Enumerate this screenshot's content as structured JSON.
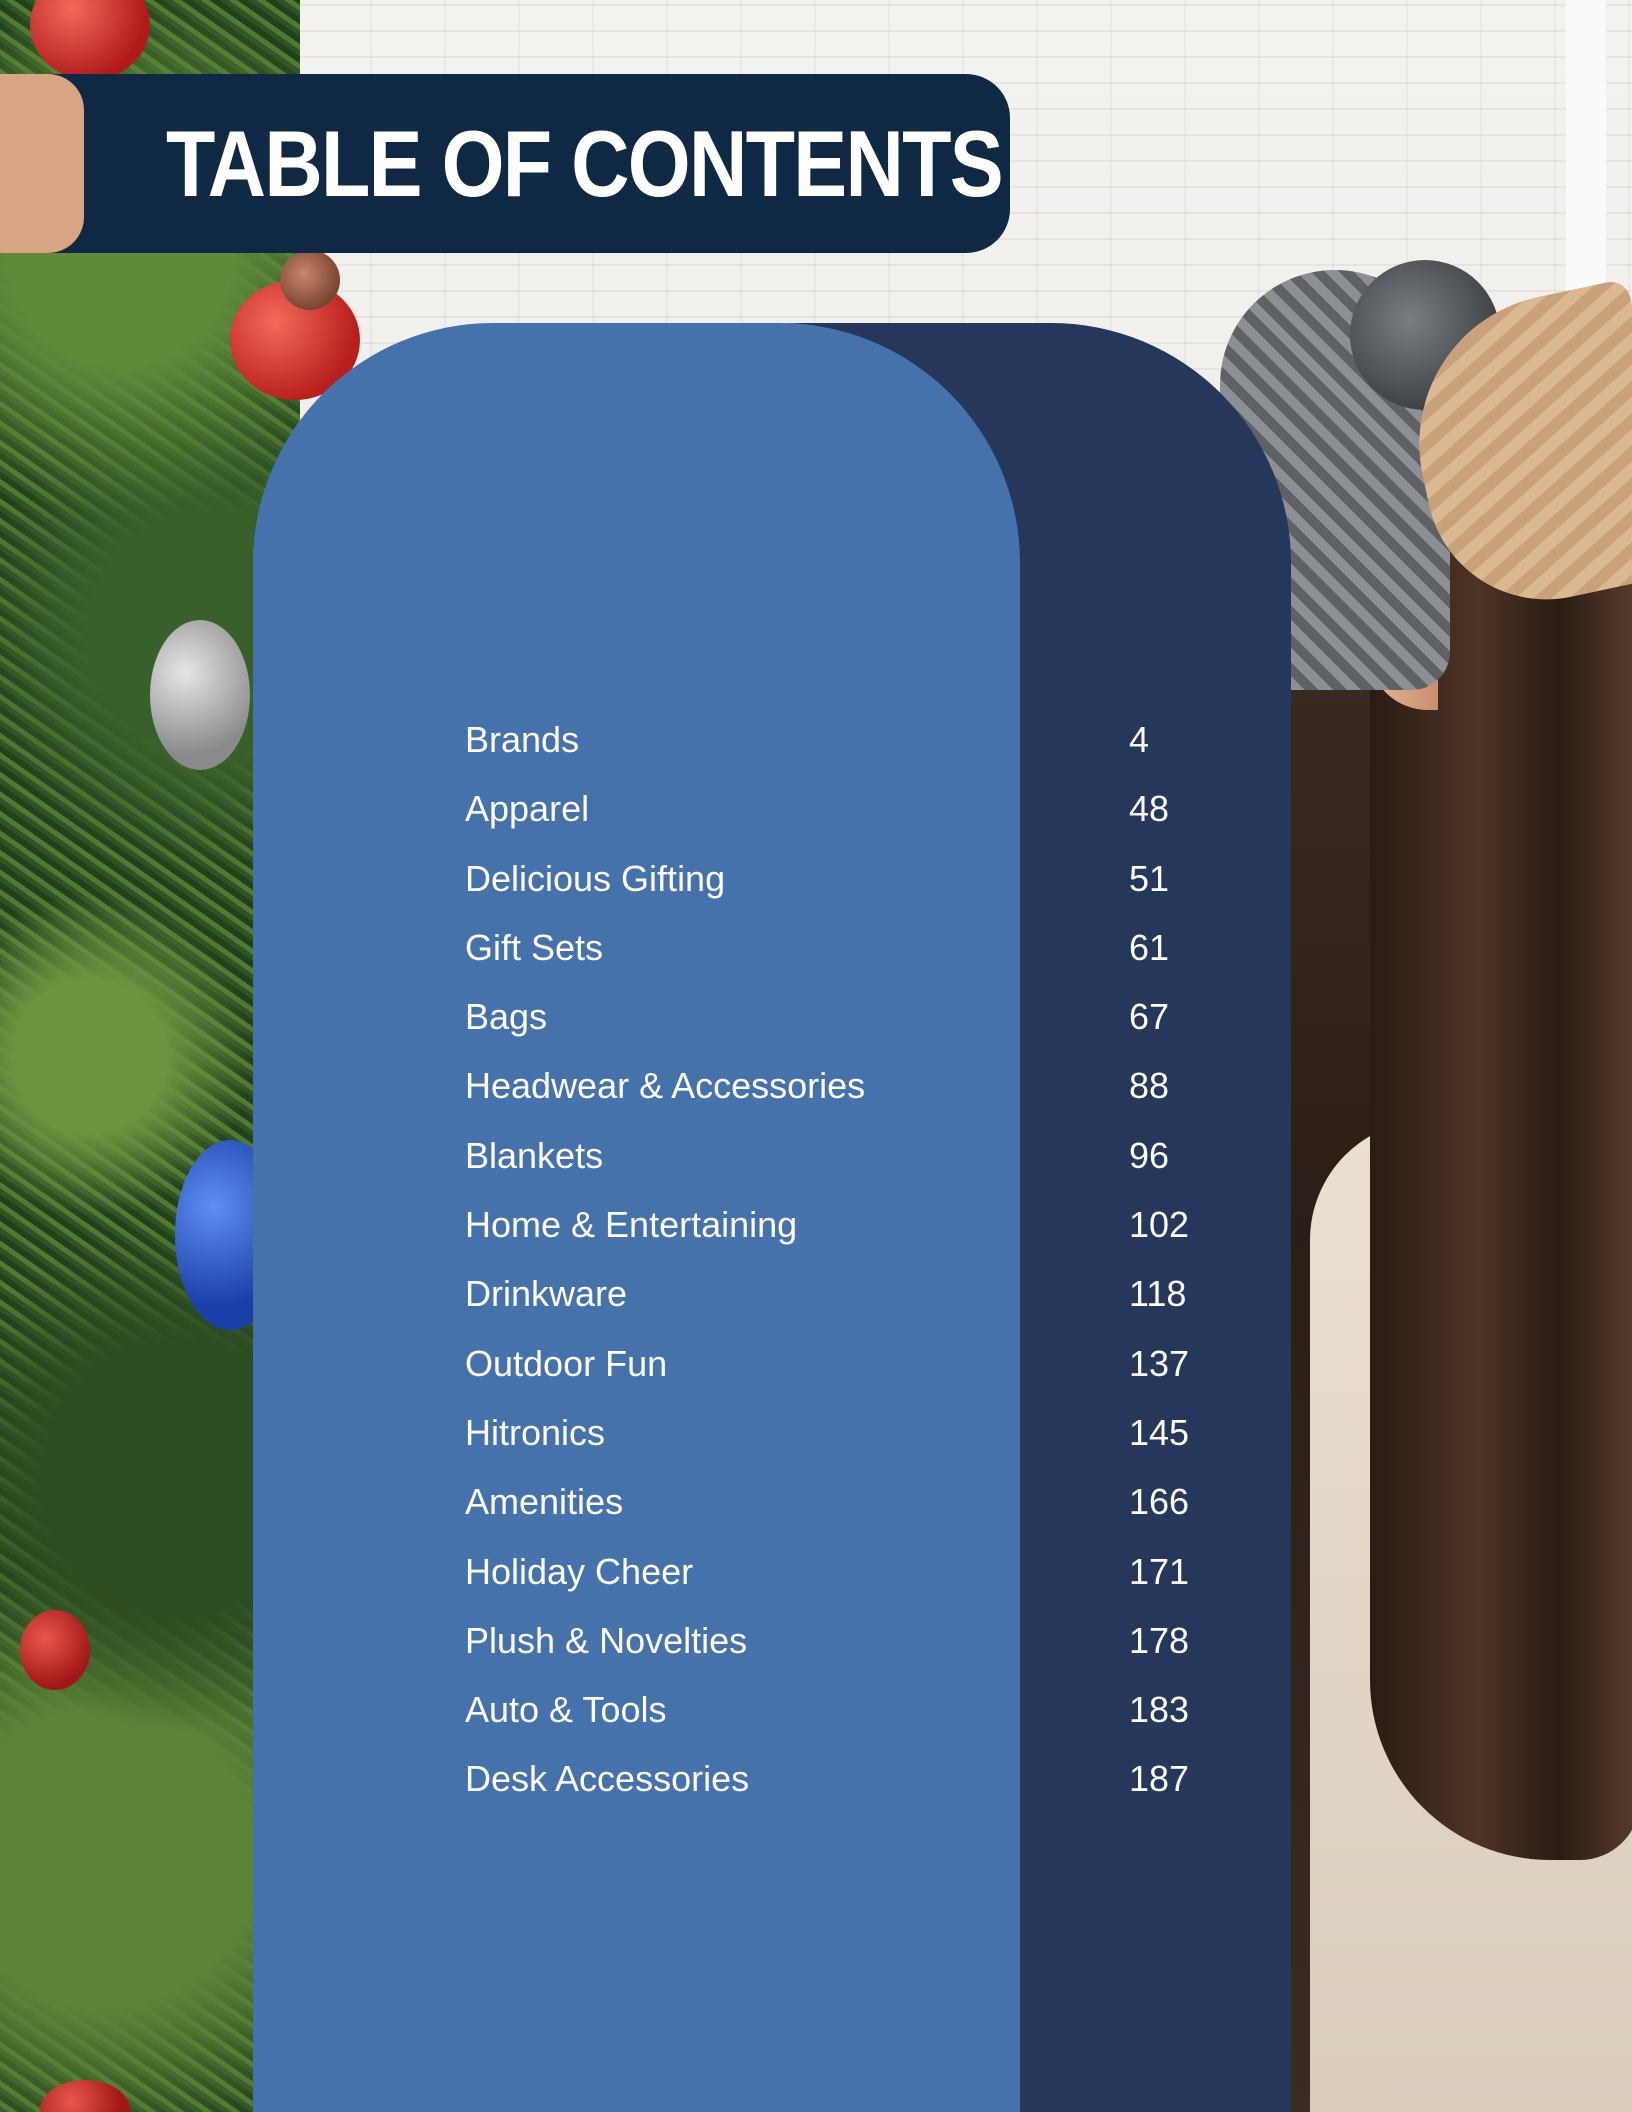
{
  "title": "TABLE OF CONTENTS",
  "colors": {
    "banner": "#0f2843",
    "banner_accent": "#d8a483",
    "panel_blue": "#4672ab",
    "panel_navy": "#25375a",
    "text": "#ffffff"
  },
  "toc": [
    {
      "label": "Brands",
      "page": "4"
    },
    {
      "label": "Apparel",
      "page": "48"
    },
    {
      "label": "Delicious Gifting",
      "page": "51"
    },
    {
      "label": "Gift Sets",
      "page": "61"
    },
    {
      "label": "Bags",
      "page": "67"
    },
    {
      "label": "Headwear & Accessories",
      "page": "88"
    },
    {
      "label": "Blankets",
      "page": "96"
    },
    {
      "label": "Home & Entertaining",
      "page": "102"
    },
    {
      "label": "Drinkware",
      "page": "118"
    },
    {
      "label": "Outdoor Fun",
      "page": "137"
    },
    {
      "label": "Hitronics",
      "page": "145"
    },
    {
      "label": "Amenities",
      "page": "166"
    },
    {
      "label": "Holiday Cheer",
      "page": "171"
    },
    {
      "label": "Plush & Novelties",
      "page": "178"
    },
    {
      "label": "Auto & Tools",
      "page": "183"
    },
    {
      "label": "Desk Accessories",
      "page": "187"
    }
  ]
}
